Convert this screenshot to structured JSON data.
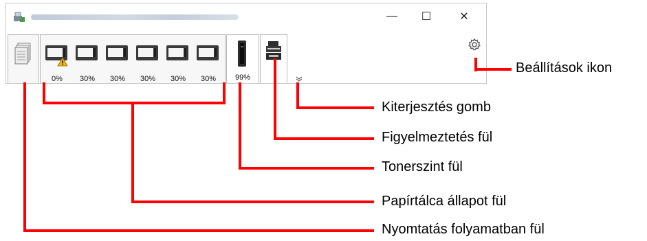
{
  "window": {
    "app_icon": "printer-window-icon",
    "title_blurred": true,
    "controls": {
      "minimize": "—",
      "maximize": "☐",
      "close": "✕"
    }
  },
  "tabs": {
    "print_progress": {
      "icon": "document-stack-icon"
    },
    "paper_trays": [
      {
        "level": "0%",
        "warning": true
      },
      {
        "level": "30%",
        "warning": false
      },
      {
        "level": "30%",
        "warning": false
      },
      {
        "level": "30%",
        "warning": false
      },
      {
        "level": "30%",
        "warning": false
      },
      {
        "level": "30%",
        "warning": false
      }
    ],
    "toner": {
      "level": "99%",
      "icon": "toner-cartridge-icon"
    },
    "alert": {
      "icon": "printer-device-icon"
    },
    "expand": {
      "icon": "chevron-down-icon"
    },
    "settings": {
      "icon": "gear-icon"
    }
  },
  "callouts": {
    "settings": "Beállítások ikon",
    "expand": "Kiterjesztés gomb",
    "alert": "Figyelmeztetés fül",
    "toner": "Tonerszint fül",
    "paper": "Papírtálca állapot fül",
    "progress": "Nyomtatás folyamatban fül"
  },
  "colors": {
    "callout_line": "#ff0000",
    "warning": "#f2b705"
  }
}
